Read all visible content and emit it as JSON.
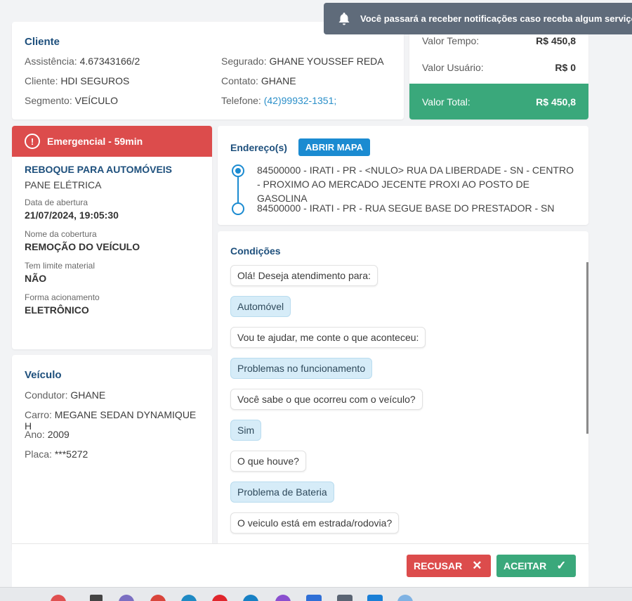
{
  "toast": {
    "icon": "bell-icon",
    "text": "Você passará a receber notificações caso receba algum serviço ou"
  },
  "cliente": {
    "title": "Cliente",
    "left": [
      {
        "label": "Assistência:",
        "value": "4.67343166/2"
      },
      {
        "label": "Cliente:",
        "value": "HDI SEGUROS"
      },
      {
        "label": "Segmento:",
        "value": "VEÍCULO"
      }
    ],
    "right": [
      {
        "label": "Segurado:",
        "value": "GHANE YOUSSEF REDA"
      },
      {
        "label": "Contato:",
        "value": "GHANE"
      },
      {
        "label": "Telefone:",
        "value": "(42)99932-1351;"
      }
    ]
  },
  "valores": {
    "tempo_label": "Valor Tempo:",
    "tempo_value": "R$ 450,8",
    "usuario_label": "Valor Usuário:",
    "usuario_value": "R$ 0",
    "total_label": "Valor Total:",
    "total_value": "R$ 450,8"
  },
  "servico": {
    "badge": "Emergencial - 59min",
    "title": "REBOQUE PARA AUTOMÓVEIS",
    "subtitle": "PANE ELÉTRICA",
    "fields": [
      {
        "label": "Data de abertura",
        "value": "21/07/2024, 19:05:30"
      },
      {
        "label": "Nome da cobertura",
        "value": "REMOÇÃO DO VEÍCULO"
      },
      {
        "label": "Tem limite material",
        "value": "NÃO"
      },
      {
        "label": "Forma acionamento",
        "value": "ELETRÔNICO"
      }
    ]
  },
  "veiculo": {
    "title": "Veículo",
    "rows": [
      {
        "label": "Condutor:",
        "value": "GHANE"
      },
      {
        "label": "Carro:",
        "value": "MEGANE SEDAN DYNAMIQUE H"
      },
      {
        "label": "Ano:",
        "value": "2009"
      },
      {
        "label": "Placa:",
        "value": "***5272"
      }
    ]
  },
  "endereco": {
    "title": "Endereço(s)",
    "map_button": "ABRIR MAPA",
    "origin": "84500000 - IRATI - PR - <NULO> RUA DA LIBERDADE - SN - CENTRO - PROXIMO AO MERCADO JECENTE PROXI AO POSTO DE GASOLINA",
    "destination": "84500000 - IRATI - PR - RUA SEGUE BASE DO PRESTADOR - SN"
  },
  "condicoes": {
    "title": "Condições",
    "messages": [
      {
        "text": "Olá! Deseja atendimento para:",
        "kind": "q"
      },
      {
        "text": "Automóvel",
        "kind": "a"
      },
      {
        "text": "Vou te ajudar, me conte o que aconteceu:",
        "kind": "q"
      },
      {
        "text": "Problemas no funcionamento",
        "kind": "a"
      },
      {
        "text": "Você sabe o que ocorreu com o veículo?",
        "kind": "q"
      },
      {
        "text": "Sim",
        "kind": "a"
      },
      {
        "text": "O que houve?",
        "kind": "q"
      },
      {
        "text": "Problema de Bateria",
        "kind": "a"
      },
      {
        "text": "O veiculo está em estrada/rodovia?",
        "kind": "q"
      }
    ]
  },
  "footer": {
    "recusar": "RECUSAR",
    "aceitar": "ACEITAR"
  },
  "colors": {
    "primary": "#1d4f7c",
    "accent": "#1b8bd1",
    "danger": "#dc4c4c",
    "success": "#3aa87b"
  }
}
